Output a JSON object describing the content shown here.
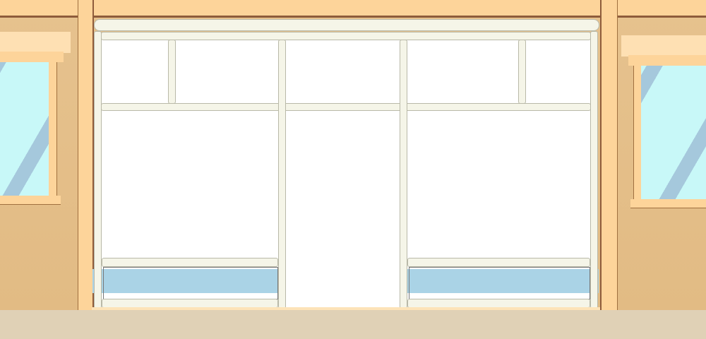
{
  "scene": "storefront-background",
  "colors": {
    "wall": "#e6c28e",
    "beam": "#fdd49a",
    "frame": "#f5f5e8",
    "glass": "#c8f8f8",
    "glass_stripe": "#a5c8dc",
    "blue_band": "#aad3e6",
    "floor": "#e0d1b6"
  }
}
